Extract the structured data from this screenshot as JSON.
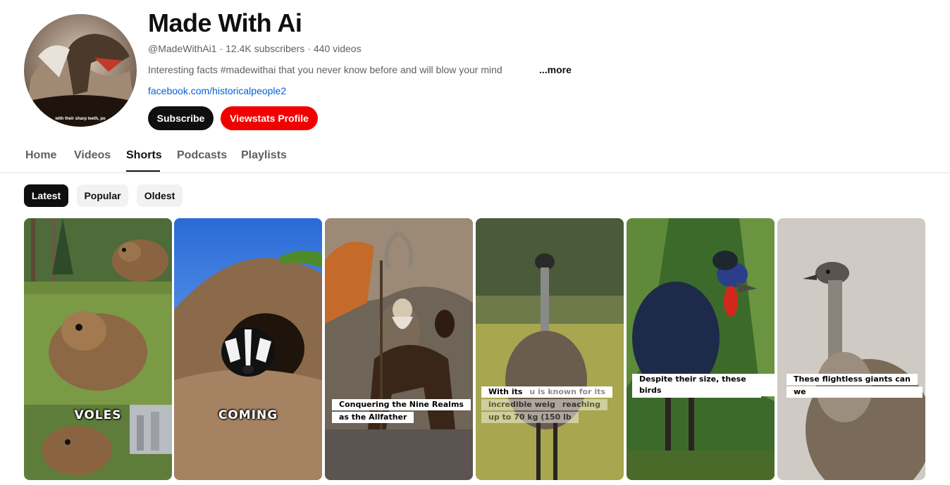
{
  "channel": {
    "name": "Made With Ai",
    "handle": "@MadeWithAi1",
    "subscribers": "12.4K subscribers",
    "videos": "440 videos",
    "description": "Interesting facts #madewithai that you never know before and will blow  your mind",
    "more_label": "...more",
    "link": "facebook.com/historicalpeople2",
    "subscribe_label": "Subscribe",
    "viewstats_label": "Viewstats Profile",
    "avatar_caption": "with their sharp teeth, po"
  },
  "tabs": [
    {
      "label": "Home",
      "active": false
    },
    {
      "label": "Videos",
      "active": false
    },
    {
      "label": "Shorts",
      "active": true
    },
    {
      "label": "Podcasts",
      "active": false
    },
    {
      "label": "Playlists",
      "active": false
    }
  ],
  "chips": [
    {
      "label": "Latest",
      "active": true
    },
    {
      "label": "Popular",
      "active": false
    },
    {
      "label": "Oldest",
      "active": false
    }
  ],
  "shorts": [
    {
      "caption": "VOLES",
      "subject": "voles in forest"
    },
    {
      "caption": "COMING",
      "subject": "badger in burrow"
    },
    {
      "caption_lines": [
        "Conquering the Nine Realms",
        "as the Allfather"
      ],
      "subject": "odin on horse"
    },
    {
      "caption_lines": [
        "With its",
        "u is known for its",
        "incredible weig",
        "reaching",
        "up to 70 kg (150 lb"
      ],
      "subject": "emu"
    },
    {
      "caption_lines": [
        "Despite their size, these birds"
      ],
      "subject": "cassowary"
    },
    {
      "caption_lines": [
        "These flightless giants can",
        "we"
      ],
      "subject": "emu portrait"
    }
  ],
  "colors": {
    "subscribe_bg": "#0f0f0f",
    "viewstats_bg": "#f20000",
    "link": "#065fd4"
  }
}
